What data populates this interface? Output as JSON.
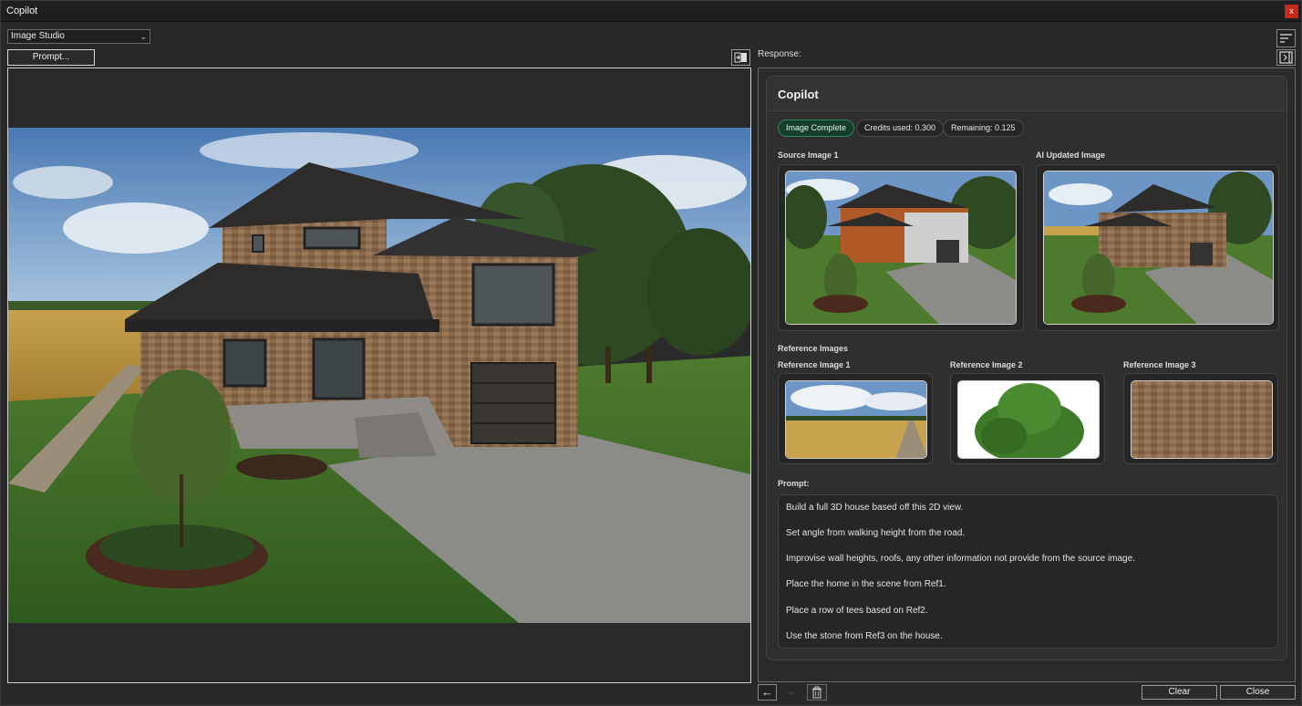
{
  "window": {
    "title": "Copilot",
    "close_glyph": "x"
  },
  "toolbar": {
    "mode_select": "Image Studio",
    "prompt_button": "Prompt..."
  },
  "response": {
    "label": "Response:",
    "card_title": "Copilot",
    "status": "Image Complete",
    "credits_used": "Credits used: 0.300",
    "remaining": "Remaining: 0.125",
    "source_label": "Source Image 1",
    "updated_label": "AI Updated Image",
    "references_header": "Reference Images",
    "references": [
      {
        "label": "Reference Image 1"
      },
      {
        "label": "Reference Image 2"
      },
      {
        "label": "Reference Image 3"
      }
    ],
    "prompt_header": "Prompt:",
    "prompt_lines": [
      "Build a full 3D house based off this 2D view.",
      "Set angle from walking height from the road.",
      "Improvise wall heights, roofs, any other information not provide from the source image.",
      "Place the home in the scene from Ref1.",
      "Place a row of tees based on Ref2.",
      "Use the stone from Ref3 on the house."
    ]
  },
  "footer": {
    "clear": "Clear",
    "close": "Close"
  },
  "icons": {
    "window_close": "close-icon",
    "select": "chevron-down-icon",
    "swap": "swap-panels-icon",
    "sort": "sort-lines-icon",
    "collapse": "collapse-panel-icon",
    "back": "arrow-left-icon",
    "forward": "arrow-right-icon",
    "delete": "trash-icon"
  },
  "colors": {
    "accent_ok": "#2d8a5d",
    "close_red": "#c42b1c",
    "panel_bg": "#282828"
  }
}
